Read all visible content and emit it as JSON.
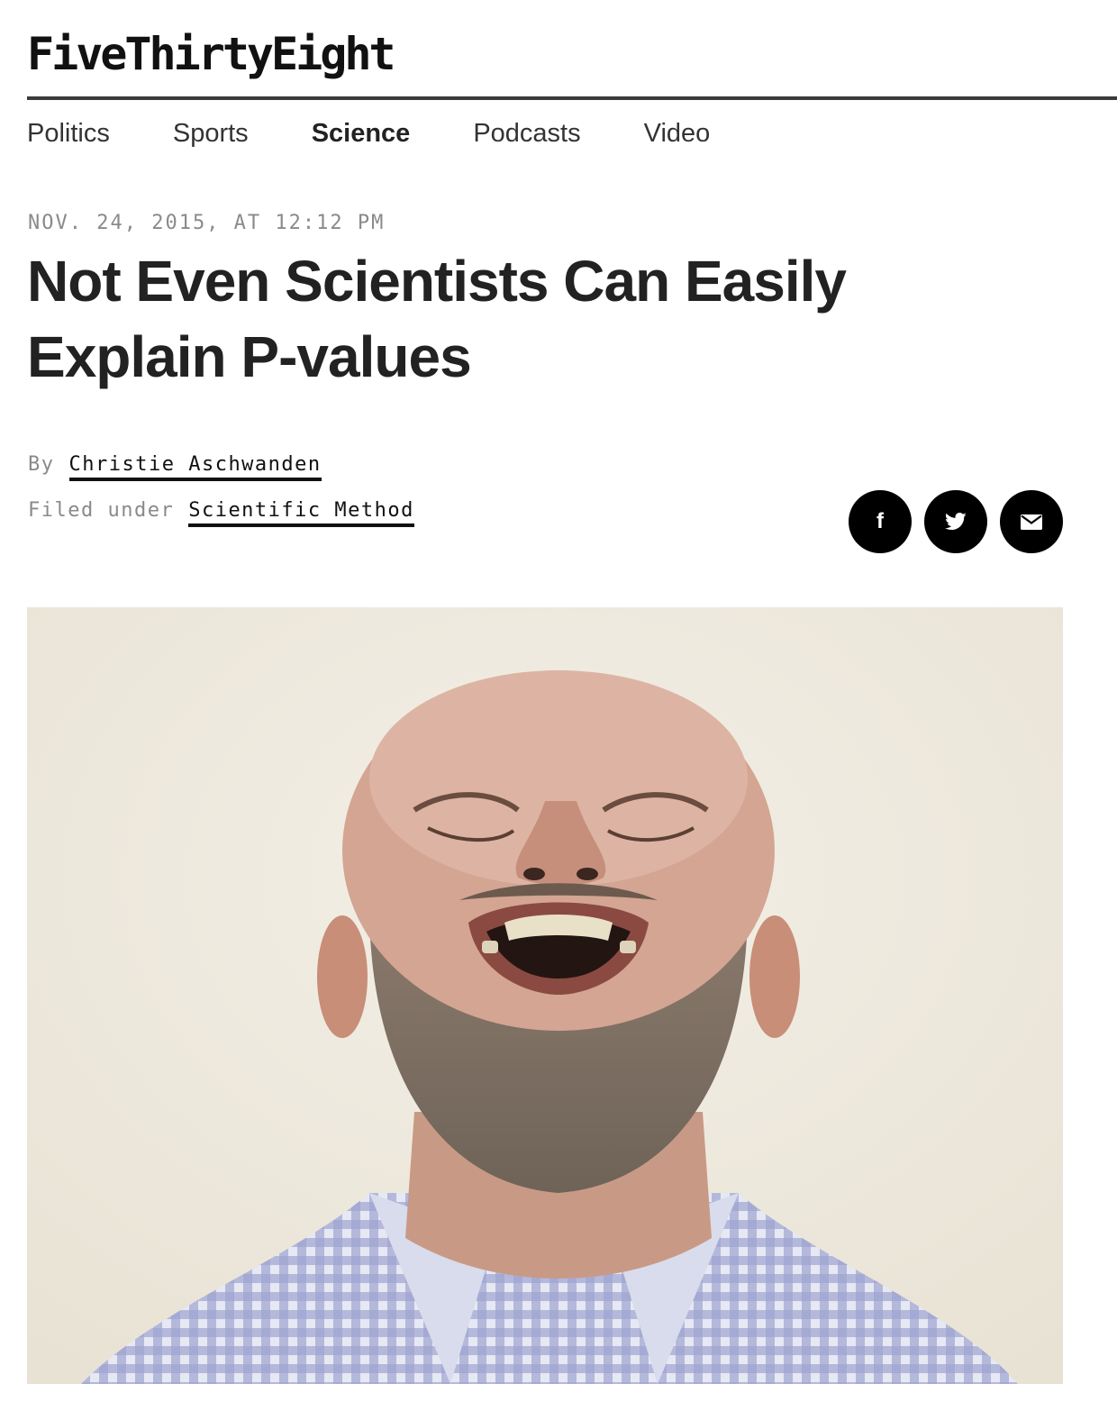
{
  "site": {
    "logo": "FiveThirtyEight"
  },
  "nav": {
    "items": [
      {
        "label": "Politics",
        "active": false
      },
      {
        "label": "Sports",
        "active": false
      },
      {
        "label": "Science",
        "active": true
      },
      {
        "label": "Podcasts",
        "active": false
      },
      {
        "label": "Video",
        "active": false
      }
    ]
  },
  "article": {
    "dateline": "NOV. 24, 2015, AT 12:12 PM",
    "title": "Not Even Scientists Can Easily Explain P-values",
    "byline_label": "By",
    "author": "Christie Aschwanden",
    "filed_label": "Filed under",
    "category": "Scientific Method"
  },
  "share": {
    "buttons": [
      {
        "icon": "facebook-icon",
        "glyph": "f"
      },
      {
        "icon": "twitter-icon"
      },
      {
        "icon": "email-icon"
      }
    ]
  },
  "hero_image": {
    "subject": "photo of a bald, bearded man laughing with head tilted back, wearing a blue checked shirt"
  },
  "colors": {
    "text": "#222222",
    "muted": "#8a8a8a",
    "rule": "#3b3b3b",
    "share_button": "#000000",
    "photo_background": "#efeae0"
  }
}
